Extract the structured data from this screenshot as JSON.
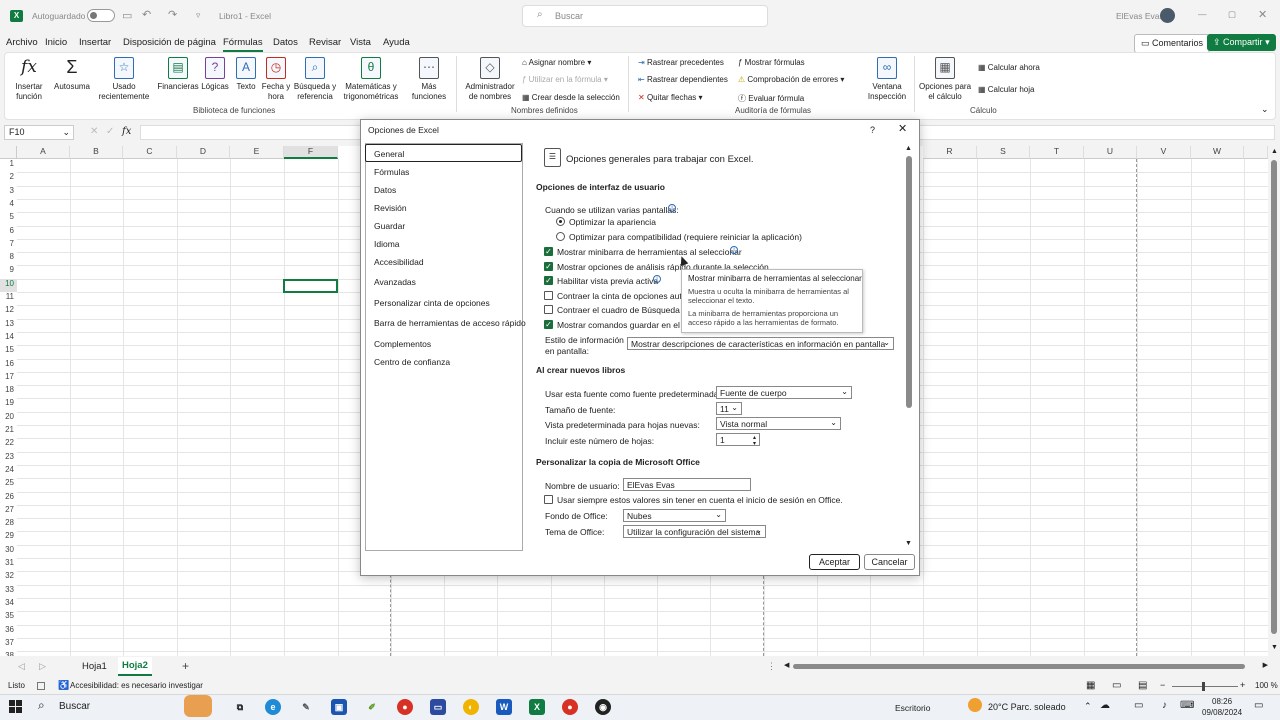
{
  "title_bar": {
    "autosave_label": "Autoguardado",
    "doc_title": "Libro1 - Excel",
    "search_placeholder": "Buscar",
    "user_name": "ElEvas Evas"
  },
  "menu": {
    "items": [
      "Archivo",
      "Inicio",
      "Insertar",
      "Disposición de página",
      "Fórmulas",
      "Datos",
      "Revisar",
      "Vista",
      "Ayuda"
    ],
    "active": "Fórmulas",
    "comments_btn": "Comentarios",
    "share_btn": "Compartir"
  },
  "ribbon": {
    "insert_function": [
      "Insertar",
      "función"
    ],
    "autosum": "Autosuma",
    "recent": [
      "Usado",
      "recientemente"
    ],
    "financial": "Financieras",
    "logical": "Lógicas",
    "text": "Texto",
    "datetime": [
      "Fecha y",
      "hora"
    ],
    "lookup": [
      "Búsqueda y",
      "referencia"
    ],
    "math": [
      "Matemáticas y",
      "trigonométricas"
    ],
    "more": [
      "Más",
      "funciones"
    ],
    "group_library": "Biblioteca de funciones",
    "name_manager": [
      "Administrador",
      "de nombres"
    ],
    "assign_name": "Asignar nombre",
    "use_in_formula": "Utilizar en la fórmula",
    "create_from_sel": "Crear desde la selección",
    "group_names": "Nombres definidos",
    "trace_precedents": "Rastrear precedentes",
    "trace_dependents": "Rastrear dependientes",
    "remove_arrows": "Quitar flechas",
    "show_formulas": "Mostrar fórmulas",
    "error_check": "Comprobación de errores",
    "evaluate": "Evaluar fórmula",
    "watch_window": [
      "Ventana",
      "Inspección"
    ],
    "group_audit": "Auditoría de fórmulas",
    "calc_options": [
      "Opciones para",
      "el cálculo"
    ],
    "calc_now": "Calcular ahora",
    "calc_sheet": "Calcular hoja",
    "group_calc": "Cálculo"
  },
  "formula_bar": {
    "name_box": "F10",
    "fx": "fx"
  },
  "grid": {
    "columns": [
      "A",
      "B",
      "C",
      "D",
      "E",
      "F",
      "R",
      "S",
      "T",
      "U",
      "V",
      "W"
    ],
    "rows": [
      "1",
      "2",
      "3",
      "4",
      "5",
      "6",
      "7",
      "8",
      "9",
      "10",
      "11",
      "12",
      "13",
      "14",
      "15",
      "16",
      "17",
      "18",
      "19",
      "20",
      "21",
      "22",
      "23",
      "24",
      "25",
      "26",
      "27",
      "28",
      "29",
      "30",
      "31",
      "32",
      "33",
      "34",
      "35",
      "36",
      "37",
      "38"
    ]
  },
  "sheets": {
    "tabs": [
      "Hoja1",
      "Hoja2"
    ],
    "active": "Hoja2"
  },
  "status": {
    "ready": "Listo",
    "accessibility": "Accesibilidad: es necesario investigar",
    "zoom": "100 %"
  },
  "taskbar": {
    "search": "Buscar",
    "desktop": "Escritorio",
    "weather": "20°C  Parc. soleado",
    "time": "08:26",
    "date": "09/08/2024"
  },
  "dialog": {
    "title": "Opciones de Excel",
    "help": "?",
    "nav": [
      "General",
      "Fórmulas",
      "Datos",
      "Revisión",
      "Guardar",
      "Idioma",
      "Accesibilidad",
      "Avanzadas",
      "Personalizar cinta de opciones",
      "Barra de herramientas de acceso rápido",
      "Complementos",
      "Centro de confianza"
    ],
    "heading": "Opciones generales para trabajar con Excel.",
    "section_ui": "Opciones de interfaz de usuario",
    "multi_screens": "Cuando se utilizan varias pantallas:",
    "opt_appearance": "Optimizar la apariencia",
    "opt_compat": "Optimizar para compatibilidad (requiere reiniciar la aplicación)",
    "chk_minibar": "Mostrar minibarra de herramientas al seleccionar",
    "chk_quick_analysis": "Mostrar opciones de análisis rápido durante la selección",
    "chk_live_preview": "Habilitar vista previa activa",
    "chk_collapse_ribbon": "Contraer la cinta de opciones autor",
    "chk_collapse_search": "Contraer el cuadro de Búsqueda de",
    "chk_show_commands": "Mostrar comandos guardar en el en",
    "screentip_label": [
      "Estilo de información",
      "en pantalla:"
    ],
    "screentip_value": "Mostrar descripciones de características en información en pantalla",
    "section_new": "Al crear nuevos libros",
    "font_label": "Usar esta fuente como fuente predeterminada:",
    "font_value": "Fuente de cuerpo",
    "size_label": "Tamaño de fuente:",
    "size_value": "11",
    "view_label": "Vista predeterminada para hojas nuevas:",
    "view_value": "Vista normal",
    "sheets_label": "Incluir este número de hojas:",
    "sheets_value": "1",
    "section_office": "Personalizar la copia de Microsoft Office",
    "username_label": "Nombre de usuario:",
    "username_value": "ElEvas Evas",
    "chk_always": "Usar siempre estos valores sin tener en cuenta el inicio de sesión en Office.",
    "background_label": "Fondo de Office:",
    "background_value": "Nubes",
    "theme_label": "Tema de Office:",
    "theme_value": "Utilizar la configuración del sistema",
    "ok": "Aceptar",
    "cancel": "Cancelar"
  },
  "tooltip": {
    "title": "Mostrar minibarra de herramientas al seleccionar",
    "line1": "Muestra u oculta la minibarra de herramientas al",
    "line2": "seleccionar el texto.",
    "line3": "La minibarra de herramientas proporciona un",
    "line4": "acceso rápido a las herramientas de formato."
  },
  "colors": {
    "accent_green": "#107c41",
    "selected_border": "#222222"
  }
}
